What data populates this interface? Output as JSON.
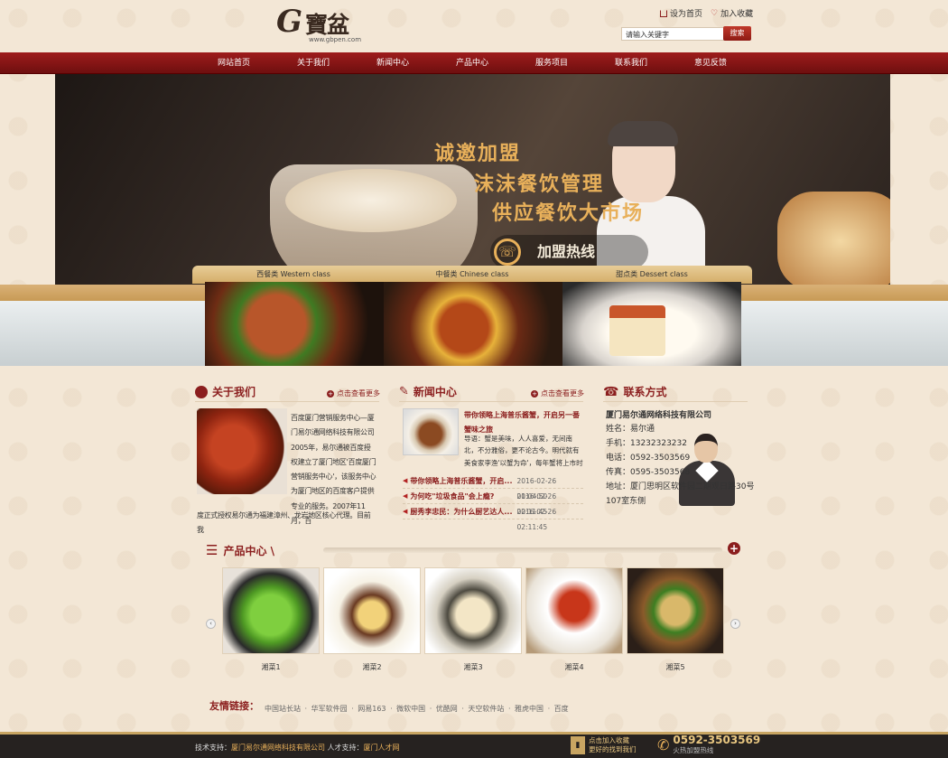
{
  "logo": {
    "mark": "G",
    "name": "寶盆",
    "url": "www.gbpen.com"
  },
  "top_links": {
    "home": "设为首页",
    "fav": "加入收藏"
  },
  "search": {
    "placeholder": "请输入关键字",
    "button": "搜索"
  },
  "nav": [
    "网站首页",
    "关于我们",
    "新闻中心",
    "产品中心",
    "服务项目",
    "联系我们",
    "意见反馈"
  ],
  "banner": {
    "line1": "诚邀加盟",
    "line2": "沫沫餐饮管理",
    "line3": "供应餐饮大市场",
    "hotline": "加盟热线"
  },
  "categories": [
    "西餐类 Western class",
    "中餐类 Chinese class",
    "甜点类 Dessert class"
  ],
  "about": {
    "title": "关于我们",
    "more": "点击查看更多",
    "text_side": "百度厦门营销服务中心—厦门易尔通网络科技有限公司2005年，易尔通被百度授权建立了厦门地区'百度厦门营销服务中心'，该服务中心为厦门地区的百度客户提供专业的服务。2007年11月，百",
    "text_bottom": "度正式授权易尔通为福建漳州、龙岩地区核心代理。目前我"
  },
  "news": {
    "title": "新闻中心",
    "more": "点击查看更多",
    "featured_title": "带你领略上海普乐酱蟹，开启另一番蟹味之旅",
    "featured_summary": "导语：蟹是美味，人人喜爱，无间南北，不分雅俗，更不论古今。明代就有美食家李渔'以蟹为命'，每年蟹将上市时",
    "items": [
      {
        "title": "带你领略上海普乐酱蟹，开启...",
        "date": "2016-02-26 01:04:50"
      },
      {
        "title": "为何吃\"垃圾食品\"会上瘾?",
        "date": "2016-02-26 02:11:45"
      },
      {
        "title": "厨秀李忠民：为什么厨艺达人...",
        "date": "2016-02-26 02:11:45"
      }
    ]
  },
  "contact": {
    "title": "联系方式",
    "company": "厦门易尔通网络科技有限公司",
    "name": "姓名：易尔通",
    "mobile": "手机：13232323232",
    "phone": "电话：0592-3503569",
    "fax": "传真：0595-3503568",
    "address1": "地址：厦门思明区软件园二期观日路30号",
    "address2": "107室东侧"
  },
  "products": {
    "title": "产品中心 \\",
    "items": [
      "湘菜1",
      "湘菜2",
      "湘菜3",
      "湘菜4",
      "湘菜5"
    ]
  },
  "links": {
    "title": "友情链接：",
    "items": "中国站长站 · 华军软件园 · 网易163 · 微软中国 · 优酷网 · 天空软件站 · 雅虎中国 · 百度"
  },
  "footer": {
    "tech_label": "技术支持：",
    "tech_company": "厦门易尔通网络科技有限公司",
    "talent_label": "人才支持：",
    "talent": "厦门人才网",
    "fav_line1": "点击加入收藏",
    "fav_line2": "更好的找到我们",
    "tel": "0592-3503569",
    "tel_sub": "火热加盟热线"
  },
  "colors": {
    "brand_red": "#8b1e1e",
    "gold": "#c8a562",
    "bg": "#f3e7d6"
  }
}
